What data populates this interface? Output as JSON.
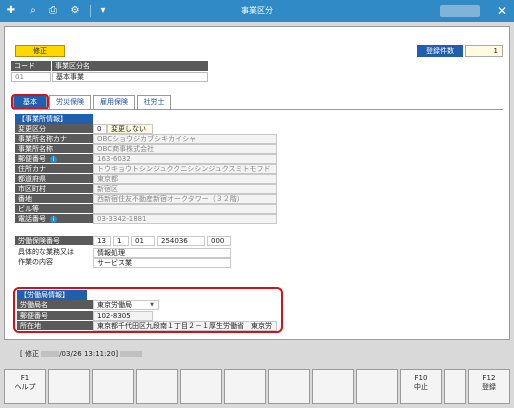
{
  "window": {
    "title": "事業区分"
  },
  "header": {
    "mode": "修正",
    "count_label": "登録件数",
    "count_value": "1",
    "code_header": "コード",
    "name_header": "事業区分名",
    "code_value": "01",
    "name_value": "基本事業"
  },
  "tabs": [
    {
      "label": "基本"
    },
    {
      "label": "労災保険"
    },
    {
      "label": "雇用保険"
    },
    {
      "label": "社労士"
    }
  ],
  "office": {
    "section": "【事業所情報】",
    "fields": [
      {
        "label": "変更区分",
        "value": "0",
        "value2": "変更しない"
      },
      {
        "label": "事業所名称カナ",
        "value": "OBCショウジカブシキカイシャ"
      },
      {
        "label": "事業所名称",
        "value": "OBC商事株式会社"
      },
      {
        "label": "郵便番号",
        "value": "163-6032"
      },
      {
        "label": "住所カナ",
        "value": "トウキョウトシンジュククニシシンジュクスミトモフド"
      },
      {
        "label": "都道府県",
        "value": "東京都"
      },
      {
        "label": "市区町村",
        "value": "新宿区"
      },
      {
        "label": "番地",
        "value": "西新宿住友不動産新宿オークタワー（３２階）"
      },
      {
        "label": "ビル等",
        "value": ""
      },
      {
        "label": "電話番号",
        "value": "03-3342-1881"
      }
    ]
  },
  "insurance": {
    "number_label": "労働保険番号",
    "number_parts": [
      "13",
      "1",
      "01",
      "254036",
      "000"
    ],
    "business_label": "具体的な業務又は",
    "business_value": "情報処理",
    "work_label": "作業の内容",
    "work_value": "サービス業"
  },
  "labor_bureau": {
    "section": "【労働局情報】",
    "fields": [
      {
        "label": "労働局名",
        "value": "東京労働局"
      },
      {
        "label": "郵便番号",
        "value": "102-8305"
      },
      {
        "label": "所在地",
        "value": "東京都千代田区九段南１丁目２－１厚生労働省　東京労"
      }
    ]
  },
  "status": {
    "prefix": "[ 修正",
    "datetime": "/03/26 13:11:20]"
  },
  "fkeys": {
    "f1_key": "F1",
    "f1_label": "ヘルプ",
    "f10_key": "F10",
    "f10_label": "中止",
    "f12_key": "F12",
    "f12_label": "登録"
  },
  "colors": {
    "accent": "#2f8ac6",
    "header_blue": "#1f5fae",
    "highlight": "#d1111b"
  }
}
